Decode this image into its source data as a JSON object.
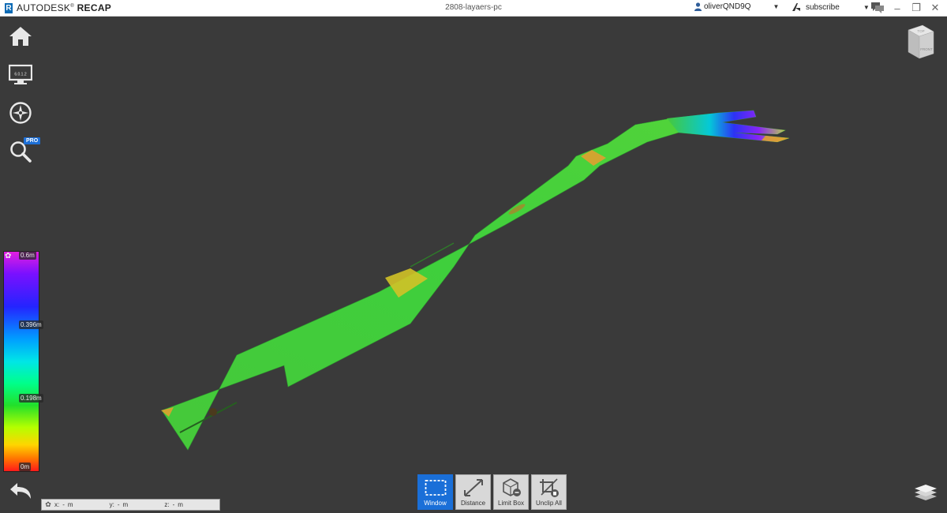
{
  "app": {
    "brand": "AUTODESK",
    "product": "RECAP",
    "document_title": "2808-layaers-pc",
    "user": "oliverQND9Q",
    "subscribe": "subscribe"
  },
  "rail": {
    "home": "home-icon",
    "display": "display-settings-icon",
    "display_text": "6.0.1.2",
    "navigate": "navigation-wheel-icon",
    "search": "search-icon",
    "pro_badge": "PRO"
  },
  "scale": {
    "labels": [
      "0.6m",
      "0.396m",
      "0.198m",
      "0m"
    ],
    "gradient_colors": [
      "#e21fe0",
      "#2424ff",
      "#00e6e6",
      "#22e02a",
      "#ffd500",
      "#ff1a1a"
    ]
  },
  "viewcube": {
    "top": "TOP",
    "front": "FRONT"
  },
  "coordinates": {
    "x_label": "x:",
    "x_value": "-",
    "x_unit": "m",
    "y_label": "y:",
    "y_value": "-",
    "y_unit": "m",
    "z_label": "z:",
    "z_value": "-",
    "z_unit": "m"
  },
  "toolbar": {
    "tools": [
      {
        "label": "Window",
        "icon": "selection-window-icon",
        "active": true
      },
      {
        "label": "Distance",
        "icon": "distance-icon",
        "active": false
      },
      {
        "label": "Limit Box",
        "icon": "limit-box-icon",
        "active": false
      },
      {
        "label": "Unclip All",
        "icon": "unclip-all-icon",
        "active": false
      }
    ]
  },
  "colors": {
    "accent": "#1a6fd8",
    "viewport_bg": "#3a3a3a",
    "point_cloud_base": "#3cc83a"
  }
}
